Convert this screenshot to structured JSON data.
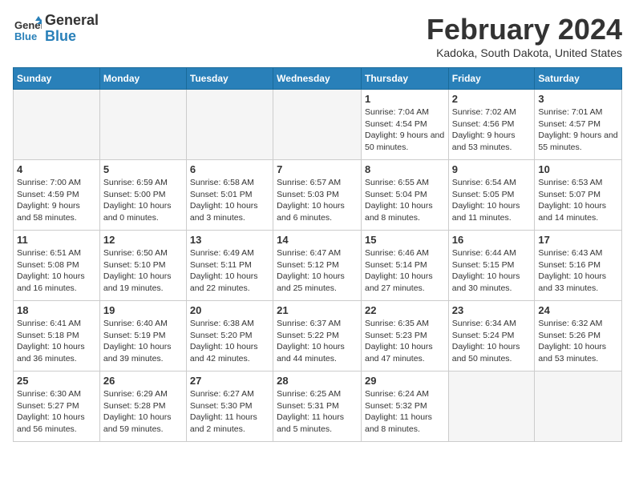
{
  "header": {
    "logo_line1": "General",
    "logo_line2": "Blue",
    "month_year": "February 2024",
    "location": "Kadoka, South Dakota, United States"
  },
  "weekdays": [
    "Sunday",
    "Monday",
    "Tuesday",
    "Wednesday",
    "Thursday",
    "Friday",
    "Saturday"
  ],
  "weeks": [
    [
      {
        "day": "",
        "empty": true
      },
      {
        "day": "",
        "empty": true
      },
      {
        "day": "",
        "empty": true
      },
      {
        "day": "",
        "empty": true
      },
      {
        "day": "1",
        "sunrise": "Sunrise: 7:04 AM",
        "sunset": "Sunset: 4:54 PM",
        "daylight": "Daylight: 9 hours and 50 minutes."
      },
      {
        "day": "2",
        "sunrise": "Sunrise: 7:02 AM",
        "sunset": "Sunset: 4:56 PM",
        "daylight": "Daylight: 9 hours and 53 minutes."
      },
      {
        "day": "3",
        "sunrise": "Sunrise: 7:01 AM",
        "sunset": "Sunset: 4:57 PM",
        "daylight": "Daylight: 9 hours and 55 minutes."
      }
    ],
    [
      {
        "day": "4",
        "sunrise": "Sunrise: 7:00 AM",
        "sunset": "Sunset: 4:59 PM",
        "daylight": "Daylight: 9 hours and 58 minutes."
      },
      {
        "day": "5",
        "sunrise": "Sunrise: 6:59 AM",
        "sunset": "Sunset: 5:00 PM",
        "daylight": "Daylight: 10 hours and 0 minutes."
      },
      {
        "day": "6",
        "sunrise": "Sunrise: 6:58 AM",
        "sunset": "Sunset: 5:01 PM",
        "daylight": "Daylight: 10 hours and 3 minutes."
      },
      {
        "day": "7",
        "sunrise": "Sunrise: 6:57 AM",
        "sunset": "Sunset: 5:03 PM",
        "daylight": "Daylight: 10 hours and 6 minutes."
      },
      {
        "day": "8",
        "sunrise": "Sunrise: 6:55 AM",
        "sunset": "Sunset: 5:04 PM",
        "daylight": "Daylight: 10 hours and 8 minutes."
      },
      {
        "day": "9",
        "sunrise": "Sunrise: 6:54 AM",
        "sunset": "Sunset: 5:05 PM",
        "daylight": "Daylight: 10 hours and 11 minutes."
      },
      {
        "day": "10",
        "sunrise": "Sunrise: 6:53 AM",
        "sunset": "Sunset: 5:07 PM",
        "daylight": "Daylight: 10 hours and 14 minutes."
      }
    ],
    [
      {
        "day": "11",
        "sunrise": "Sunrise: 6:51 AM",
        "sunset": "Sunset: 5:08 PM",
        "daylight": "Daylight: 10 hours and 16 minutes."
      },
      {
        "day": "12",
        "sunrise": "Sunrise: 6:50 AM",
        "sunset": "Sunset: 5:10 PM",
        "daylight": "Daylight: 10 hours and 19 minutes."
      },
      {
        "day": "13",
        "sunrise": "Sunrise: 6:49 AM",
        "sunset": "Sunset: 5:11 PM",
        "daylight": "Daylight: 10 hours and 22 minutes."
      },
      {
        "day": "14",
        "sunrise": "Sunrise: 6:47 AM",
        "sunset": "Sunset: 5:12 PM",
        "daylight": "Daylight: 10 hours and 25 minutes."
      },
      {
        "day": "15",
        "sunrise": "Sunrise: 6:46 AM",
        "sunset": "Sunset: 5:14 PM",
        "daylight": "Daylight: 10 hours and 27 minutes."
      },
      {
        "day": "16",
        "sunrise": "Sunrise: 6:44 AM",
        "sunset": "Sunset: 5:15 PM",
        "daylight": "Daylight: 10 hours and 30 minutes."
      },
      {
        "day": "17",
        "sunrise": "Sunrise: 6:43 AM",
        "sunset": "Sunset: 5:16 PM",
        "daylight": "Daylight: 10 hours and 33 minutes."
      }
    ],
    [
      {
        "day": "18",
        "sunrise": "Sunrise: 6:41 AM",
        "sunset": "Sunset: 5:18 PM",
        "daylight": "Daylight: 10 hours and 36 minutes."
      },
      {
        "day": "19",
        "sunrise": "Sunrise: 6:40 AM",
        "sunset": "Sunset: 5:19 PM",
        "daylight": "Daylight: 10 hours and 39 minutes."
      },
      {
        "day": "20",
        "sunrise": "Sunrise: 6:38 AM",
        "sunset": "Sunset: 5:20 PM",
        "daylight": "Daylight: 10 hours and 42 minutes."
      },
      {
        "day": "21",
        "sunrise": "Sunrise: 6:37 AM",
        "sunset": "Sunset: 5:22 PM",
        "daylight": "Daylight: 10 hours and 44 minutes."
      },
      {
        "day": "22",
        "sunrise": "Sunrise: 6:35 AM",
        "sunset": "Sunset: 5:23 PM",
        "daylight": "Daylight: 10 hours and 47 minutes."
      },
      {
        "day": "23",
        "sunrise": "Sunrise: 6:34 AM",
        "sunset": "Sunset: 5:24 PM",
        "daylight": "Daylight: 10 hours and 50 minutes."
      },
      {
        "day": "24",
        "sunrise": "Sunrise: 6:32 AM",
        "sunset": "Sunset: 5:26 PM",
        "daylight": "Daylight: 10 hours and 53 minutes."
      }
    ],
    [
      {
        "day": "25",
        "sunrise": "Sunrise: 6:30 AM",
        "sunset": "Sunset: 5:27 PM",
        "daylight": "Daylight: 10 hours and 56 minutes."
      },
      {
        "day": "26",
        "sunrise": "Sunrise: 6:29 AM",
        "sunset": "Sunset: 5:28 PM",
        "daylight": "Daylight: 10 hours and 59 minutes."
      },
      {
        "day": "27",
        "sunrise": "Sunrise: 6:27 AM",
        "sunset": "Sunset: 5:30 PM",
        "daylight": "Daylight: 11 hours and 2 minutes."
      },
      {
        "day": "28",
        "sunrise": "Sunrise: 6:25 AM",
        "sunset": "Sunset: 5:31 PM",
        "daylight": "Daylight: 11 hours and 5 minutes."
      },
      {
        "day": "29",
        "sunrise": "Sunrise: 6:24 AM",
        "sunset": "Sunset: 5:32 PM",
        "daylight": "Daylight: 11 hours and 8 minutes."
      },
      {
        "day": "",
        "empty": true
      },
      {
        "day": "",
        "empty": true
      }
    ]
  ]
}
